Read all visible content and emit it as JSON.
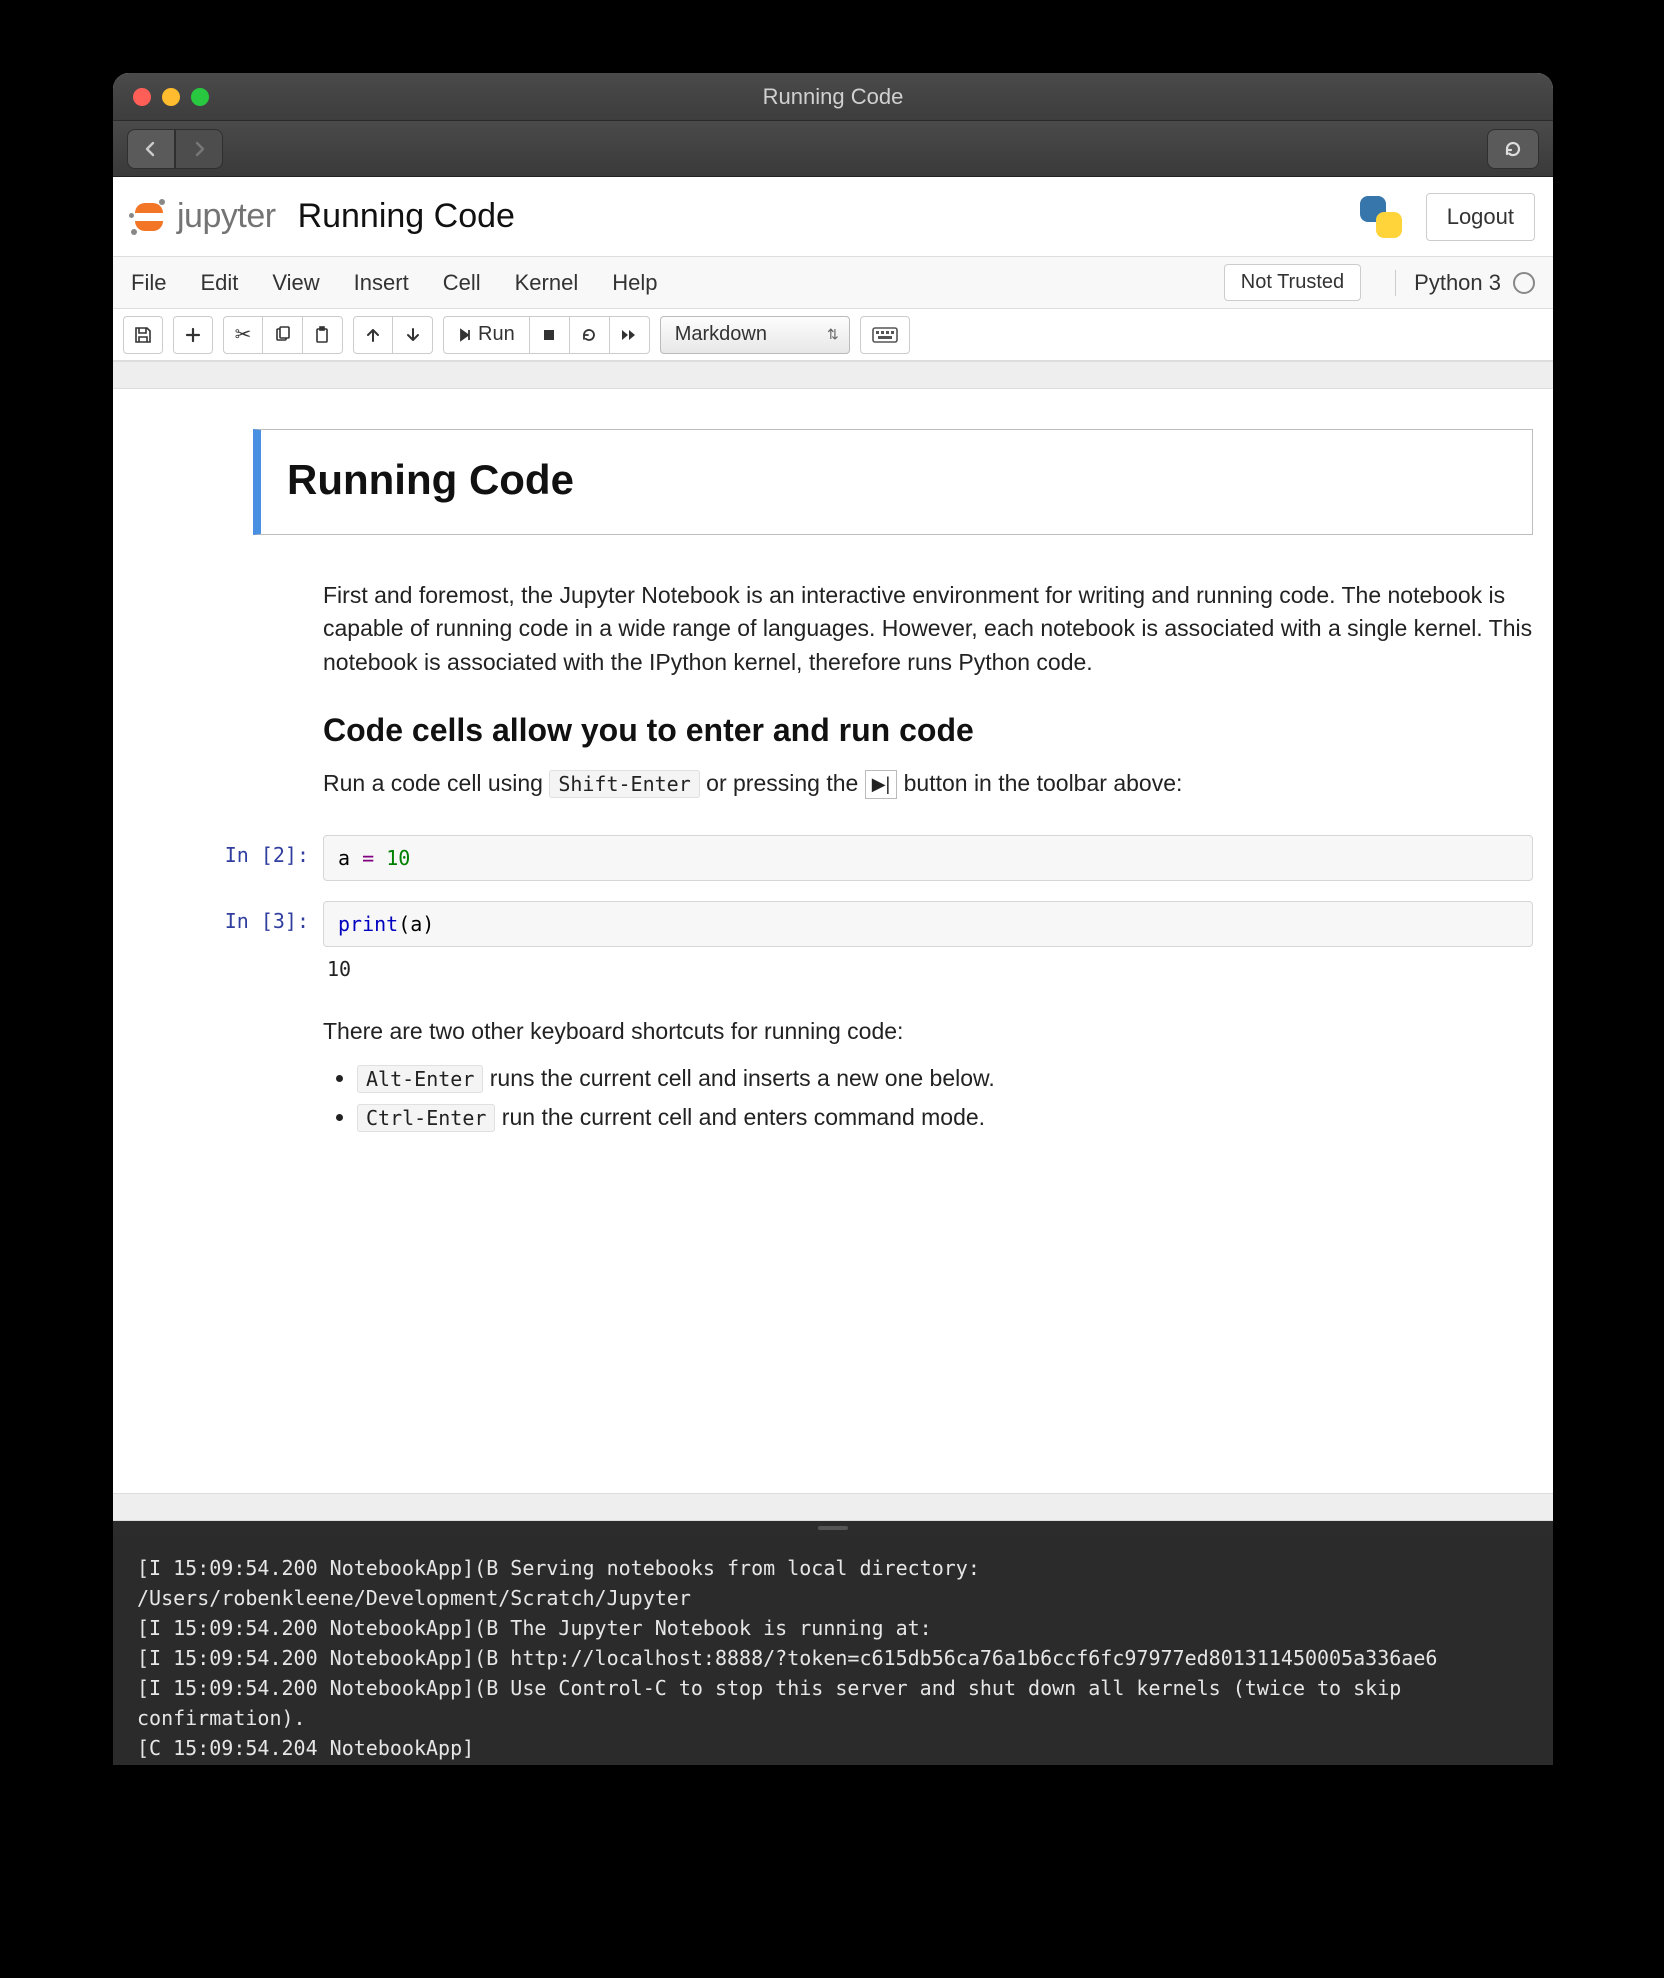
{
  "window": {
    "title": "Running Code"
  },
  "jupyter": {
    "logo_text": "jupyter",
    "notebook_name": "Running Code",
    "logout": "Logout",
    "menus": [
      "File",
      "Edit",
      "View",
      "Insert",
      "Cell",
      "Kernel",
      "Help"
    ],
    "trust_label": "Not Trusted",
    "kernel_name": "Python 3",
    "run_label": "Run",
    "celltype": "Markdown"
  },
  "notebook": {
    "h1": "Running Code",
    "intro": "First and foremost, the Jupyter Notebook is an interactive environment for writing and running code. The notebook is capable of running code in a wide range of languages. However, each notebook is associated with a single kernel. This notebook is associated with the IPython kernel, therefore runs Python code.",
    "h2": "Code cells allow you to enter and run code",
    "run_hint_pre": "Run a code cell using ",
    "run_hint_kbd": "Shift-Enter",
    "run_hint_mid": " or pressing the ",
    "run_hint_post": " button in the toolbar above:",
    "cells": [
      {
        "prompt": "In [2]:",
        "code_html": "a <span class='tok-op'>=</span> <span class='tok-num'>10</span>"
      },
      {
        "prompt": "In [3]:",
        "code_html": "<span class='tok-fn'>print</span>(a)",
        "output": "10"
      }
    ],
    "shortcuts_intro": "There are two other keyboard shortcuts for running code:",
    "shortcuts": [
      {
        "kbd": "Alt-Enter",
        "text": " runs the current cell and inserts a new one below."
      },
      {
        "kbd": "Ctrl-Enter",
        "text": " run the current cell and enters command mode."
      }
    ]
  },
  "terminal": {
    "lines": [
      "[I 15:09:54.200 NotebookApp](B Serving notebooks from local directory: /Users/robenkleene/Development/Scratch/Jupyter",
      "[I 15:09:54.200 NotebookApp](B The Jupyter Notebook is running at:",
      "[I 15:09:54.200 NotebookApp](B http://localhost:8888/?token=c615db56ca76a1b6ccf6fc97977ed801311450005a336ae6",
      "[I 15:09:54.200 NotebookApp](B Use Control-C to stop this server and shut down all kernels (twice to skip confirmation).",
      "[C 15:09:54.204 NotebookApp]"
    ]
  }
}
